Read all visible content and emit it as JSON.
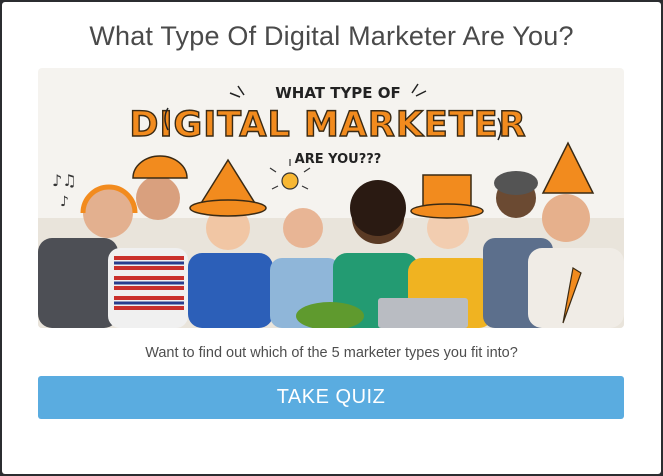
{
  "modal": {
    "title": "What Type Of Digital Marketer Are You?",
    "subtitle": "Want to find out which of the 5 marketer types you fit into?",
    "cta_label": "TAKE QUIZ"
  },
  "banner": {
    "line1": "WHAT TYPE OF",
    "line2": "DIGITAL MARKETER",
    "line3": "ARE YOU???"
  },
  "colors": {
    "accent_orange": "#f28b1e",
    "button_blue": "#5aace0",
    "title_gray": "#4a4a4a"
  }
}
